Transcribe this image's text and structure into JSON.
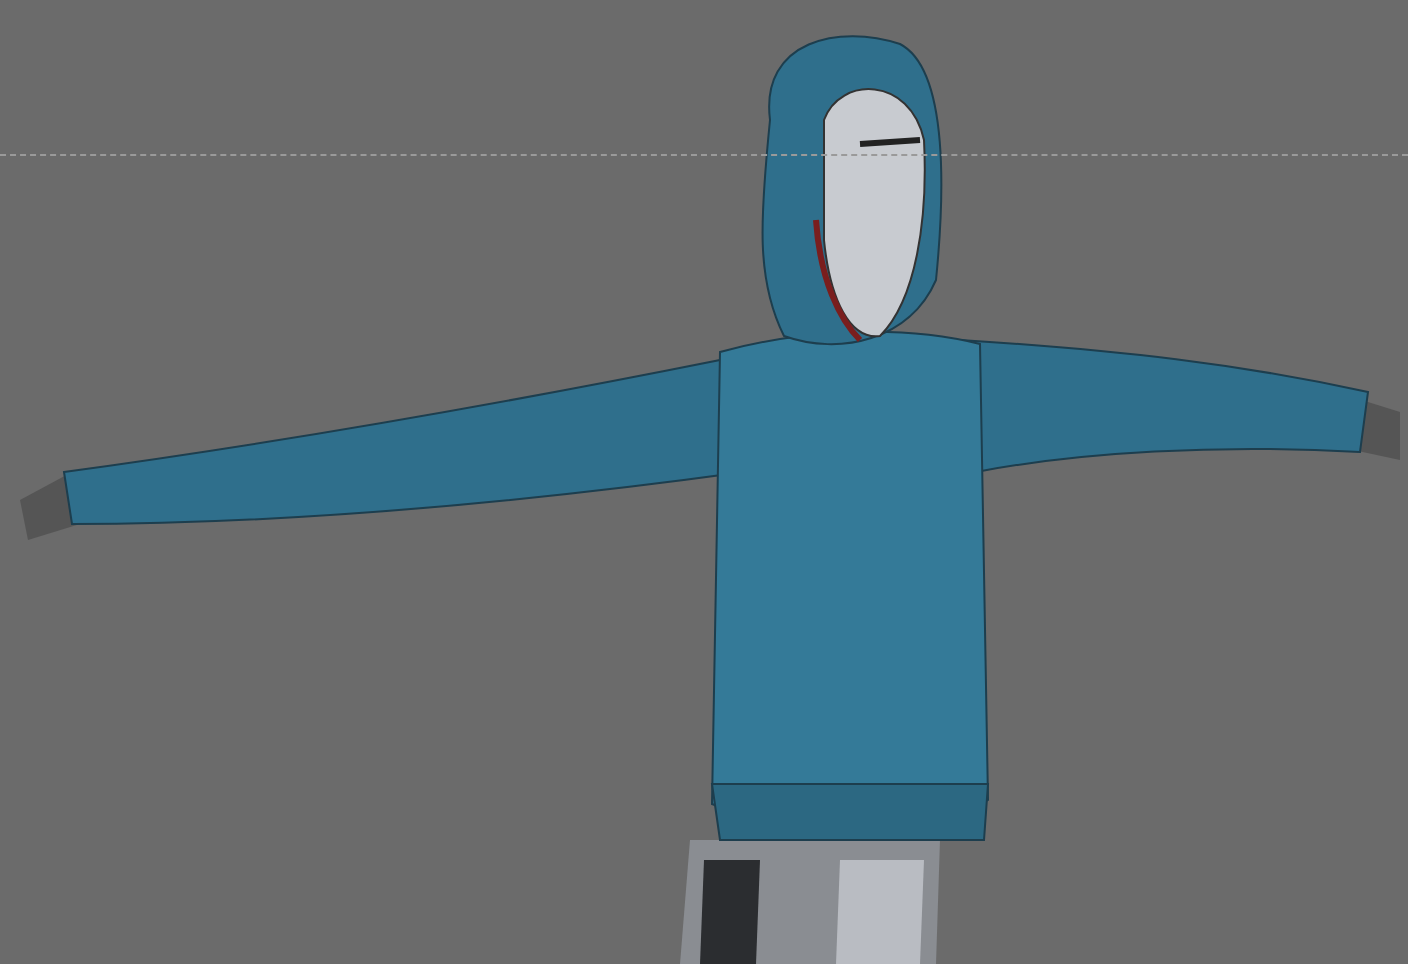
{
  "viewport": {
    "horizon_line": true
  }
}
